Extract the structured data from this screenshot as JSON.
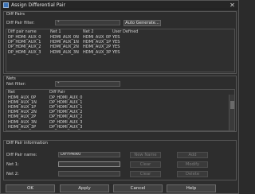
{
  "window": {
    "title": "Assign Differential Pair",
    "close_glyph": "✕"
  },
  "diff_pairs": {
    "title": "Diff Pairs",
    "filter_label": "Diff Pair filter:",
    "filter_value": "*",
    "auto_generate_label": "Auto Generate...",
    "headers": [
      "Diff pair name",
      "Net 1",
      "Net 2",
      "User Defined"
    ],
    "rows": [
      [
        "DP_HDMI_AUX_0",
        "HDMI_AUX_0N",
        "HDMI_AUX_0P",
        "YES"
      ],
      [
        "DP_HDMI_AUX_1",
        "HDMI_AUX_1N",
        "HDMI_AUX_1P",
        "YES"
      ],
      [
        "DP_HDMI_AUX_2",
        "HDMI_AUX_2N",
        "HDMI_AUX_2P",
        "YES"
      ],
      [
        "DP_HDMI_AUX_3",
        "HDMI_AUX_3N",
        "HDMI_AUX_3P",
        "YES"
      ]
    ]
  },
  "nets": {
    "title": "Nets",
    "filter_label": "Net filter:",
    "filter_value": "*",
    "headers": [
      "Net",
      "Diff Pair"
    ],
    "rows": [
      [
        "HDMI_AUX_0P",
        "DP_HDMI_AUX_0"
      ],
      [
        "HDMI_AUX_1N",
        "DP_HDMI_AUX_1"
      ],
      [
        "HDMI_AUX_1P",
        "DP_HDMI_AUX_1"
      ],
      [
        "HDMI_AUX_2N",
        "DP_HDMI_AUX_2"
      ],
      [
        "HDMI_AUX_2P",
        "DP_HDMI_AUX_2"
      ],
      [
        "HDMI_AUX_3N",
        "DP_HDMI_AUX_3"
      ],
      [
        "HDMI_AUX_3P",
        "DP_HDMI_AUX_3"
      ]
    ]
  },
  "diff_pair_info": {
    "title": "Diff Pair information",
    "name_label": "Diff Pair name:",
    "name_value": "DIFFPAIR0",
    "net1_label": "Net 1:",
    "net1_value": "",
    "net2_label": "Net 2:",
    "net2_value": "",
    "buttons": {
      "new_name": "New Name",
      "clear1": "Clear",
      "clear2": "Clear",
      "add": "Add",
      "modify": "Modify",
      "delete": "Delete"
    }
  },
  "footer": {
    "ok": "OK",
    "apply": "Apply",
    "cancel": "Cancel",
    "help": "Help"
  }
}
